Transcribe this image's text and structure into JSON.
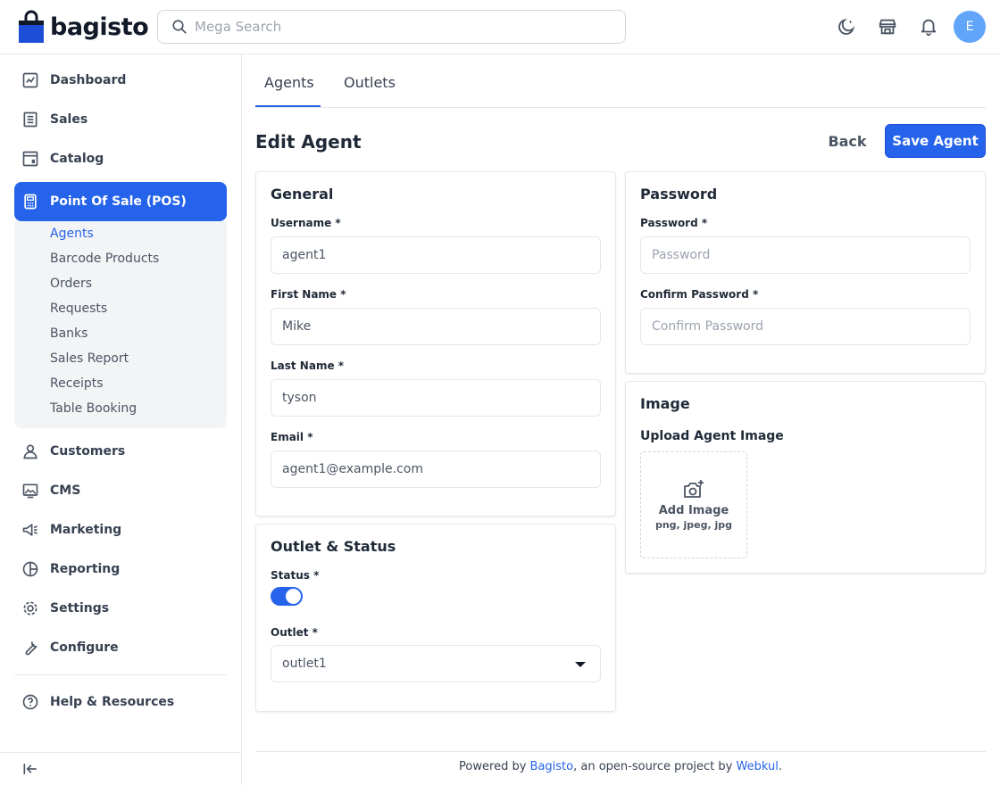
{
  "header": {
    "brand": "bagisto",
    "search_placeholder": "Mega Search",
    "avatar_initial": "E"
  },
  "sidebar": {
    "items": [
      {
        "label": "Dashboard",
        "icon": "dashboard-icon"
      },
      {
        "label": "Sales",
        "icon": "sales-icon"
      },
      {
        "label": "Catalog",
        "icon": "catalog-icon"
      },
      {
        "label": "Point Of Sale (POS)",
        "icon": "pos-icon",
        "active": true
      },
      {
        "label": "Customers",
        "icon": "customers-icon"
      },
      {
        "label": "CMS",
        "icon": "cms-icon"
      },
      {
        "label": "Marketing",
        "icon": "marketing-icon"
      },
      {
        "label": "Reporting",
        "icon": "reporting-icon"
      },
      {
        "label": "Settings",
        "icon": "settings-icon"
      },
      {
        "label": "Configure",
        "icon": "configure-icon"
      },
      {
        "label": "Help & Resources",
        "icon": "help-icon"
      }
    ],
    "pos_sub": [
      "Agents",
      "Barcode Products",
      "Orders",
      "Requests",
      "Banks",
      "Sales Report",
      "Receipts",
      "Table Booking"
    ]
  },
  "tabs": [
    "Agents",
    "Outlets"
  ],
  "page": {
    "title": "Edit Agent",
    "back_label": "Back",
    "save_label": "Save Agent"
  },
  "general": {
    "title": "General",
    "username_label": "Username *",
    "username_value": "agent1",
    "first_name_label": "First Name *",
    "first_name_value": "Mike",
    "last_name_label": "Last Name *",
    "last_name_value": "tyson",
    "email_label": "Email *",
    "email_value": "agent1@example.com"
  },
  "outlet_status": {
    "title": "Outlet & Status",
    "status_label": "Status *",
    "status_on": true,
    "outlet_label": "Outlet *",
    "outlet_value": "outlet1"
  },
  "password": {
    "title": "Password",
    "password_label": "Password *",
    "password_placeholder": "Password",
    "confirm_label": "Confirm Password *",
    "confirm_placeholder": "Confirm Password"
  },
  "image": {
    "title": "Image",
    "upload_label": "Upload Agent Image",
    "add_image": "Add Image",
    "formats": "png, jpeg, jpg"
  },
  "footer": {
    "prefix": "Powered by ",
    "bagisto": "Bagisto",
    "middle": ", an open-source project by ",
    "webkul": "Webkul",
    "suffix": "."
  },
  "colors": {
    "accent": "#2563eb",
    "avatar": "#60a5fa"
  }
}
